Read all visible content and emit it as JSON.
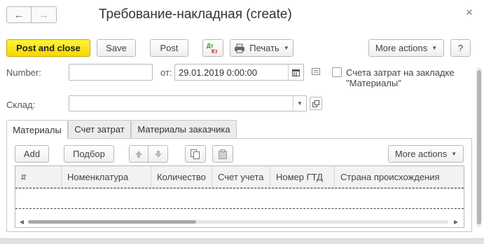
{
  "window": {
    "title": "Требование-накладная (create)",
    "close_glyph": "×",
    "back_glyph": "←",
    "forward_glyph": "→"
  },
  "toolbar": {
    "post_and_close": "Post and close",
    "save": "Save",
    "post": "Post",
    "dt_kt_top": "Дт",
    "dt_kt_bottom": "Кт",
    "print": "Печать",
    "more_actions": "More actions",
    "help": "?"
  },
  "form": {
    "number_label": "Number:",
    "number_value": "",
    "date_label": "от:",
    "date_value": "29.01.2019  0:00:00",
    "cost_checkbox_label_line1": "Счета затрат на закладке",
    "cost_checkbox_label_line2": "\"Материалы\"",
    "cost_checkbox_checked": false,
    "warehouse_label": "Склад:",
    "warehouse_value": ""
  },
  "tabs": [
    {
      "label": "Материалы",
      "active": true
    },
    {
      "label": "Счет затрат",
      "active": false
    },
    {
      "label": "Материалы заказчика",
      "active": false
    }
  ],
  "table_toolbar": {
    "add": "Add",
    "select": "Подбор",
    "more_actions": "More actions"
  },
  "table": {
    "columns": [
      "#",
      "Номенклатура",
      "Количество",
      "Счет учета",
      "Номер ГТД",
      "Страна происхождения"
    ],
    "rows": []
  },
  "colors": {
    "primary_button": "#f5d800",
    "border": "#b9b9b9",
    "background": "#ffffff"
  }
}
